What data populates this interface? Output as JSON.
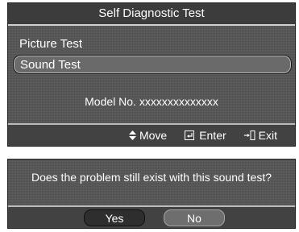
{
  "diagnostic": {
    "title": "Self Diagnostic Test",
    "items": [
      {
        "label": "Picture Test"
      },
      {
        "label": "Sound Test"
      }
    ],
    "model": "Model No. xxxxxxxxxxxxxx"
  },
  "footer": {
    "move_label": "Move",
    "enter_label": "Enter",
    "exit_label": "Exit",
    "move_icon": "updown-arrows-icon",
    "enter_icon": "enter-icon",
    "exit_icon": "exit-icon"
  },
  "dialog": {
    "question": "Does the problem still exist with this sound test?",
    "yes_label": "Yes",
    "no_label": "No"
  },
  "colors": {
    "panel": "#555555",
    "bar": "#424242",
    "text": "#ffffff"
  }
}
